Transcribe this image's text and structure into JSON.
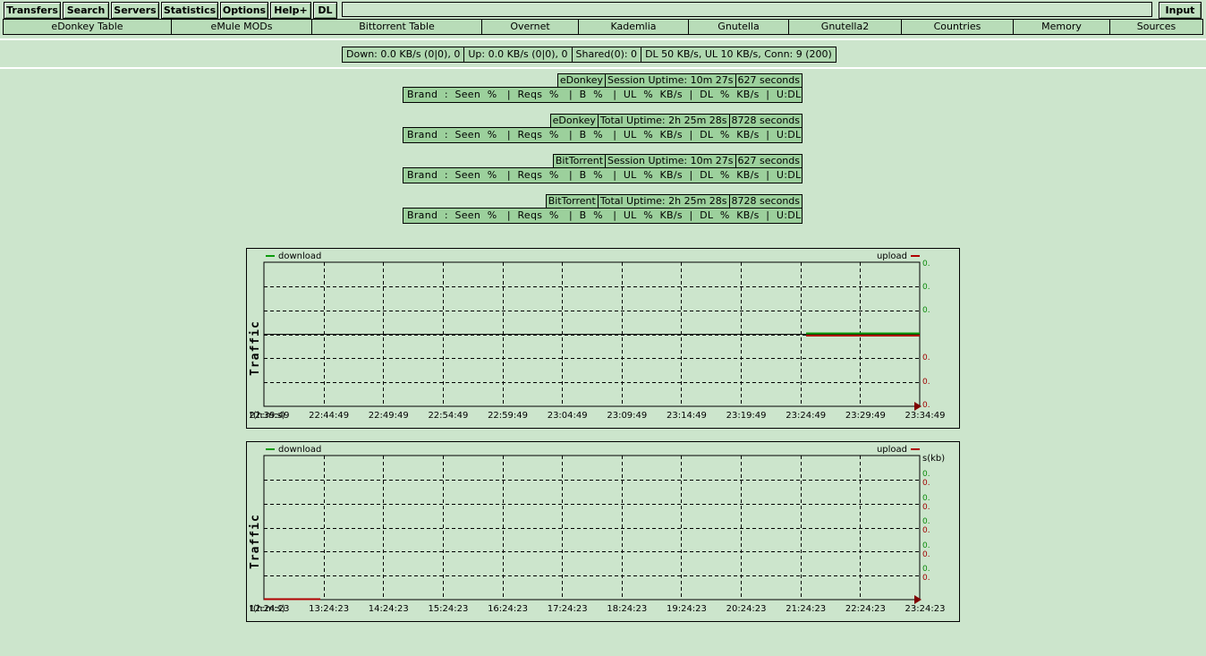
{
  "toolbar": {
    "buttons": [
      "Transfers",
      "Search",
      "Servers",
      "Statistics",
      "Options",
      "Help+",
      "DL"
    ],
    "input_value": "",
    "input_button": "Input"
  },
  "subtabs": [
    "eDonkey Table",
    "eMule MODs",
    "Bittorrent Table",
    "Overnet",
    "Kademlia",
    "Gnutella",
    "Gnutella2",
    "Countries",
    "Memory",
    "Sources"
  ],
  "status": [
    "Down: 0.0 KB/s (0|0), 0",
    "Up: 0.0 KB/s (0|0), 0",
    "Shared(0): 0",
    "DL 50 KB/s, UL 10 KB/s, Conn: 9 (200)"
  ],
  "brand_tables": [
    {
      "network": "eDonkey",
      "uptime": "Session Uptime: 10m 27s",
      "seconds": "627 seconds",
      "row": "Brand  :  Seen  %   |  Reqs  %   |  B  %   |  UL  %  KB/s  |  DL  %  KB/s  |  U:DL"
    },
    {
      "network": "eDonkey",
      "uptime": "Total Uptime: 2h 25m 28s",
      "seconds": "8728 seconds",
      "row": "Brand  :  Seen  %   |  Reqs  %   |  B  %   |  UL  %  KB/s  |  DL  %  KB/s  |  U:DL"
    },
    {
      "network": "BitTorrent",
      "uptime": "Session Uptime: 10m 27s",
      "seconds": "627 seconds",
      "row": "Brand  :  Seen  %   |  Reqs  %   |  B  %   |  UL  %  KB/s  |  DL  %  KB/s  |  U:DL"
    },
    {
      "network": "BitTorrent",
      "uptime": "Total Uptime: 2h 25m 28s",
      "seconds": "8728 seconds",
      "row": "Brand  :  Seen  %   |  Reqs  %   |  B  %   |  UL  %  KB/s  |  DL  %  KB/s  |  U:DL"
    }
  ],
  "graphs": [
    {
      "legend_download": "download",
      "legend_upload": "upload",
      "ylabel": "Traffic",
      "tlabel": "t(h:m:s)",
      "unit": "",
      "xticks": [
        "22:39:49",
        "22:44:49",
        "22:49:49",
        "22:54:49",
        "22:59:49",
        "23:04:49",
        "23:09:49",
        "23:14:49",
        "23:19:49",
        "23:24:49",
        "23:29:49",
        "23:34:49"
      ],
      "right_values": [
        {
          "text": "0.",
          "color": "green"
        },
        {
          "text": "0.",
          "color": "green"
        },
        {
          "text": "0.",
          "color": "green"
        },
        {
          "text": "0.",
          "color": "red"
        },
        {
          "text": "0.",
          "color": "red"
        },
        {
          "text": "0.",
          "color": "red"
        }
      ],
      "colors": {
        "download": "#0a9a0a",
        "upload": "#b00000"
      }
    },
    {
      "legend_download": "download",
      "legend_upload": "upload",
      "ylabel": "Traffic",
      "tlabel": "t(h:m:s)",
      "unit": "s(kb)",
      "xticks": [
        "12:24:23",
        "13:24:23",
        "14:24:23",
        "15:24:23",
        "16:24:23",
        "17:24:23",
        "18:24:23",
        "19:24:23",
        "20:24:23",
        "21:24:23",
        "22:24:23",
        "23:24:23"
      ],
      "right_values": [
        {
          "text": "0.",
          "color": "green"
        },
        {
          "text": "0.",
          "color": "red"
        },
        {
          "text": "0.",
          "color": "green"
        },
        {
          "text": "0.",
          "color": "red"
        },
        {
          "text": "0.",
          "color": "green"
        },
        {
          "text": "0.",
          "color": "red"
        },
        {
          "text": "0.",
          "color": "green"
        },
        {
          "text": "0.",
          "color": "red"
        },
        {
          "text": "0.",
          "color": "green"
        },
        {
          "text": "0.",
          "color": "red"
        }
      ],
      "colors": {
        "download": "#0a9a0a",
        "upload": "#b00000"
      }
    }
  ]
}
